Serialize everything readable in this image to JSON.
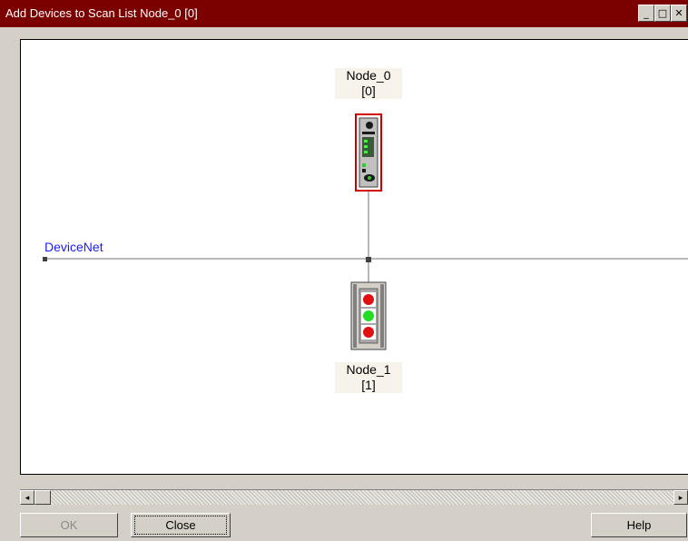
{
  "window": {
    "title": "Add Devices to Scan List Node_0 [0]",
    "controls": {
      "minimize": "_",
      "maximize": "□",
      "close": "✕"
    }
  },
  "network": {
    "label": "DeviceNet"
  },
  "nodes": [
    {
      "name": "Node_0",
      "address": "[0]",
      "device_icon": "scanner-module-icon"
    },
    {
      "name": "Node_1",
      "address": "[1]",
      "device_icon": "stack-light-icon"
    }
  ],
  "buttons": {
    "ok": "OK",
    "close": "Close",
    "help": "Help"
  },
  "scrollbar": {
    "left_arrow": "◂",
    "right_arrow": "▸"
  },
  "colors": {
    "titlebar": "#7b0000",
    "network_label": "#1a1aff",
    "selected_border": "#cc0000",
    "light_red": "#e01010",
    "light_green": "#22dd22"
  }
}
